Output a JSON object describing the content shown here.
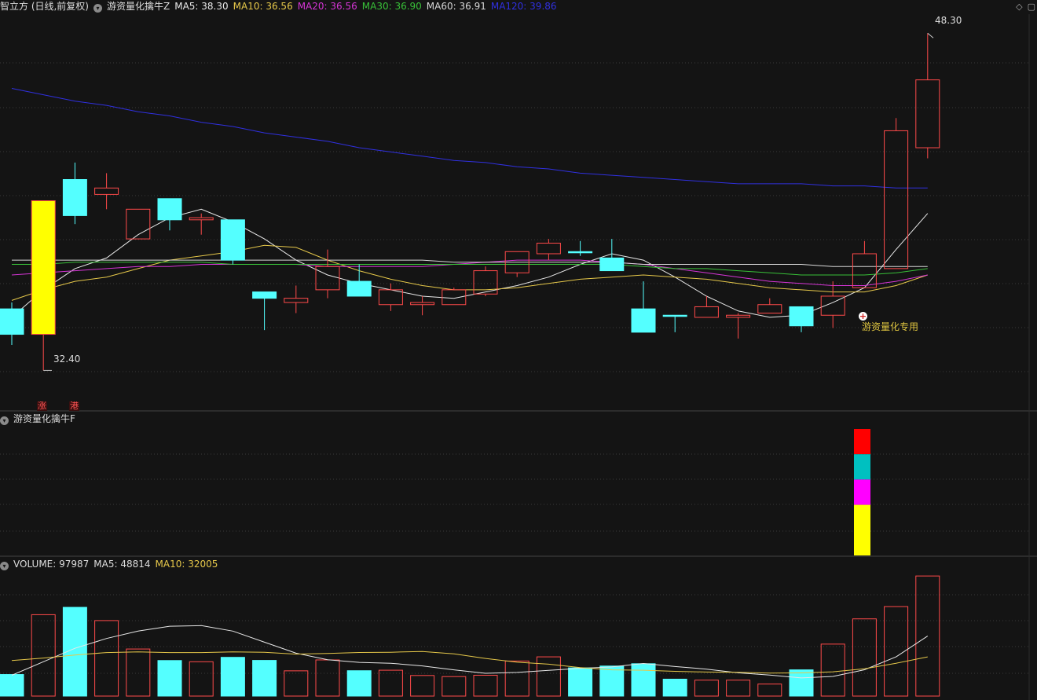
{
  "header": {
    "title": "智立方 (日线,前复权)",
    "indicator": "游资量化擒牛Z",
    "ma_items": [
      {
        "label": "MA5: 38.30",
        "color": "#e8e8e8"
      },
      {
        "label": "MA10: 36.56",
        "color": "#e6c84a"
      },
      {
        "label": "MA20: 36.56",
        "color": "#d535d5"
      },
      {
        "label": "MA30: 36.90",
        "color": "#38c038"
      },
      {
        "label": "MA60: 36.91",
        "color": "#d8d8d8"
      },
      {
        "label": "MA120: 39.86",
        "color": "#3030e0"
      }
    ]
  },
  "panel2": {
    "title": "游资量化擒牛F"
  },
  "volume_header": {
    "items": [
      {
        "label": "VOLUME: 97987",
        "color": "#dddddd"
      },
      {
        "label": "MA5: 48814",
        "color": "#dddddd"
      },
      {
        "label": "MA10: 32005",
        "color": "#e6c84a"
      }
    ]
  },
  "annotations": {
    "high_label": "48.30",
    "low_label": "32.40",
    "signal_text": "游资量化专用",
    "tag1": "涨",
    "tag2": "港"
  },
  "colors": {
    "up": "#ff4a4a",
    "down": "#54ffff",
    "special": "#ffff00"
  },
  "chart_data": [
    {
      "type": "candlestick",
      "title": "智立方 (日线,前复权)",
      "yrange": [
        30.6,
        49.2
      ],
      "candles": [
        {
          "open": 35.3,
          "close": 34.1,
          "high": 35.6,
          "low": 33.6,
          "dir": "down"
        },
        {
          "open": 34.1,
          "close": 40.4,
          "high": 40.4,
          "low": 32.4,
          "dir": "special"
        },
        {
          "open": 41.4,
          "close": 39.7,
          "high": 42.2,
          "low": 39.3,
          "dir": "down"
        },
        {
          "open": 40.7,
          "close": 41.0,
          "high": 41.7,
          "low": 40.0,
          "dir": "up"
        },
        {
          "open": 38.6,
          "close": 40.0,
          "high": 40.0,
          "low": 38.6,
          "dir": "up"
        },
        {
          "open": 40.5,
          "close": 39.5,
          "high": 40.5,
          "low": 39.0,
          "dir": "down"
        },
        {
          "open": 39.6,
          "close": 39.5,
          "high": 39.8,
          "low": 38.8,
          "dir": "up"
        },
        {
          "open": 39.5,
          "close": 37.6,
          "high": 39.5,
          "low": 37.4,
          "dir": "down"
        },
        {
          "open": 36.1,
          "close": 35.8,
          "high": 36.1,
          "low": 34.3,
          "dir": "down"
        },
        {
          "open": 35.6,
          "close": 35.8,
          "high": 36.4,
          "low": 35.1,
          "dir": "up"
        },
        {
          "open": 36.2,
          "close": 37.3,
          "high": 38.1,
          "low": 35.8,
          "dir": "up"
        },
        {
          "open": 36.6,
          "close": 35.9,
          "high": 37.4,
          "low": 35.9,
          "dir": "down"
        },
        {
          "open": 35.5,
          "close": 36.2,
          "high": 36.5,
          "low": 35.2,
          "dir": "up"
        },
        {
          "open": 35.5,
          "close": 35.6,
          "high": 35.9,
          "low": 35.0,
          "dir": "up"
        },
        {
          "open": 35.5,
          "close": 36.2,
          "high": 36.3,
          "low": 35.5,
          "dir": "up"
        },
        {
          "open": 36.0,
          "close": 37.1,
          "high": 37.3,
          "low": 35.9,
          "dir": "up"
        },
        {
          "open": 37.0,
          "close": 38.0,
          "high": 38.0,
          "low": 36.8,
          "dir": "up"
        },
        {
          "open": 37.9,
          "close": 38.4,
          "high": 38.6,
          "low": 37.6,
          "dir": "up"
        },
        {
          "open": 38.0,
          "close": 38.0,
          "high": 38.5,
          "low": 37.8,
          "dir": "down"
        },
        {
          "open": 37.7,
          "close": 37.1,
          "high": 38.6,
          "low": 37.1,
          "dir": "down"
        },
        {
          "open": 35.3,
          "close": 34.2,
          "high": 36.6,
          "low": 34.2,
          "dir": "down"
        },
        {
          "open": 35.0,
          "close": 35.0,
          "high": 35.0,
          "low": 34.2,
          "dir": "down"
        },
        {
          "open": 34.9,
          "close": 35.4,
          "high": 35.9,
          "low": 34.9,
          "dir": "up"
        },
        {
          "open": 34.9,
          "close": 35.0,
          "high": 35.1,
          "low": 33.9,
          "dir": "up"
        },
        {
          "open": 35.1,
          "close": 35.5,
          "high": 35.8,
          "low": 35.1,
          "dir": "up"
        },
        {
          "open": 35.4,
          "close": 34.5,
          "high": 35.4,
          "low": 34.2,
          "dir": "down"
        },
        {
          "open": 35.0,
          "close": 35.9,
          "high": 36.6,
          "low": 34.4,
          "dir": "up"
        },
        {
          "open": 36.3,
          "close": 37.9,
          "high": 38.5,
          "low": 36.3,
          "dir": "up"
        },
        {
          "open": 37.2,
          "close": 43.7,
          "high": 44.3,
          "low": 37.2,
          "dir": "up"
        },
        {
          "open": 42.9,
          "close": 46.1,
          "high": 48.3,
          "low": 42.4,
          "dir": "up"
        }
      ],
      "ma_lines": [
        {
          "name": "MA5",
          "color": "#e8e8e8",
          "values": [
            34.9,
            36.2,
            37.2,
            37.7,
            38.8,
            39.6,
            40.0,
            39.4,
            38.6,
            37.6,
            36.9,
            36.5,
            36.2,
            35.9,
            35.8,
            36.1,
            36.4,
            36.8,
            37.4,
            37.9,
            37.6,
            36.8,
            35.9,
            35.2,
            34.9,
            35.0,
            35.6,
            36.3,
            38.1,
            39.8
          ]
        },
        {
          "name": "MA10",
          "color": "#e6c84a",
          "values": [
            35.7,
            36.2,
            36.6,
            36.8,
            37.2,
            37.6,
            37.8,
            38.0,
            38.3,
            38.2,
            37.6,
            37.1,
            36.7,
            36.4,
            36.2,
            36.2,
            36.3,
            36.5,
            36.7,
            36.8,
            36.9,
            36.8,
            36.7,
            36.5,
            36.3,
            36.2,
            36.1,
            36.1,
            36.4,
            36.9
          ]
        },
        {
          "name": "MA20",
          "color": "#d535d5",
          "values": [
            36.9,
            37.0,
            37.1,
            37.2,
            37.3,
            37.3,
            37.4,
            37.4,
            37.4,
            37.4,
            37.3,
            37.3,
            37.3,
            37.3,
            37.4,
            37.5,
            37.6,
            37.6,
            37.6,
            37.5,
            37.4,
            37.2,
            37.0,
            36.8,
            36.6,
            36.5,
            36.4,
            36.4,
            36.6,
            36.9
          ]
        },
        {
          "name": "MA30",
          "color": "#38c038",
          "values": [
            37.4,
            37.4,
            37.5,
            37.5,
            37.5,
            37.5,
            37.5,
            37.4,
            37.4,
            37.4,
            37.4,
            37.4,
            37.4,
            37.4,
            37.4,
            37.4,
            37.4,
            37.4,
            37.4,
            37.4,
            37.3,
            37.2,
            37.2,
            37.1,
            37.0,
            36.9,
            36.9,
            36.9,
            37.0,
            37.2
          ]
        },
        {
          "name": "MA60",
          "color": "#d8d8d8",
          "values": [
            37.6,
            37.6,
            37.6,
            37.6,
            37.6,
            37.6,
            37.6,
            37.6,
            37.6,
            37.6,
            37.6,
            37.6,
            37.6,
            37.6,
            37.5,
            37.5,
            37.5,
            37.5,
            37.5,
            37.5,
            37.4,
            37.4,
            37.4,
            37.4,
            37.4,
            37.4,
            37.3,
            37.3,
            37.3,
            37.3
          ]
        },
        {
          "name": "MA120",
          "color": "#3030e0",
          "values": [
            45.7,
            45.4,
            45.1,
            44.9,
            44.6,
            44.4,
            44.1,
            43.9,
            43.6,
            43.4,
            43.2,
            42.9,
            42.7,
            42.5,
            42.3,
            42.2,
            42.0,
            41.9,
            41.7,
            41.6,
            41.5,
            41.4,
            41.3,
            41.2,
            41.2,
            41.2,
            41.1,
            41.1,
            41.0,
            41.0
          ]
        }
      ]
    },
    {
      "type": "bar",
      "title": "游资量化擒牛F",
      "stack": [
        {
          "color": "#ff0000",
          "value": 1
        },
        {
          "color": "#00c0c0",
          "value": 1
        },
        {
          "color": "#ff00ff",
          "value": 1
        },
        {
          "color": "#ffff00",
          "value": 2
        }
      ]
    },
    {
      "type": "bar",
      "title": "VOLUME",
      "ylim": [
        0,
        100000
      ],
      "volumes": [
        17600,
        66400,
        72400,
        61600,
        38400,
        29000,
        28000,
        31600,
        29100,
        20600,
        29500,
        20700,
        21100,
        16800,
        15900,
        17000,
        28600,
        32000,
        23000,
        24500,
        26400,
        13800,
        13000,
        13000,
        9800,
        21400,
        42400,
        63000,
        73000,
        97987
      ],
      "ma_lines": [
        {
          "name": "MA5",
          "color": "#e8e8e8",
          "values": [
            17000,
            28000,
            39000,
            47000,
            53000,
            57000,
            57500,
            53000,
            44000,
            35000,
            29600,
            27500,
            26800,
            24600,
            21400,
            18600,
            19300,
            21000,
            22600,
            23800,
            26600,
            24100,
            22000,
            19000,
            17100,
            14800,
            16000,
            21500,
            32000,
            49000
          ]
        },
        {
          "name": "MA10",
          "color": "#e6c84a",
          "values": [
            29000,
            31000,
            33500,
            35500,
            36000,
            35500,
            35500,
            36000,
            35800,
            34200,
            34800,
            35600,
            35800,
            36400,
            34500,
            30700,
            27600,
            26000,
            23200,
            21400,
            21100,
            20200,
            19600,
            19400,
            18800,
            18900,
            19800,
            22300,
            26800,
            32005
          ]
        }
      ]
    }
  ]
}
